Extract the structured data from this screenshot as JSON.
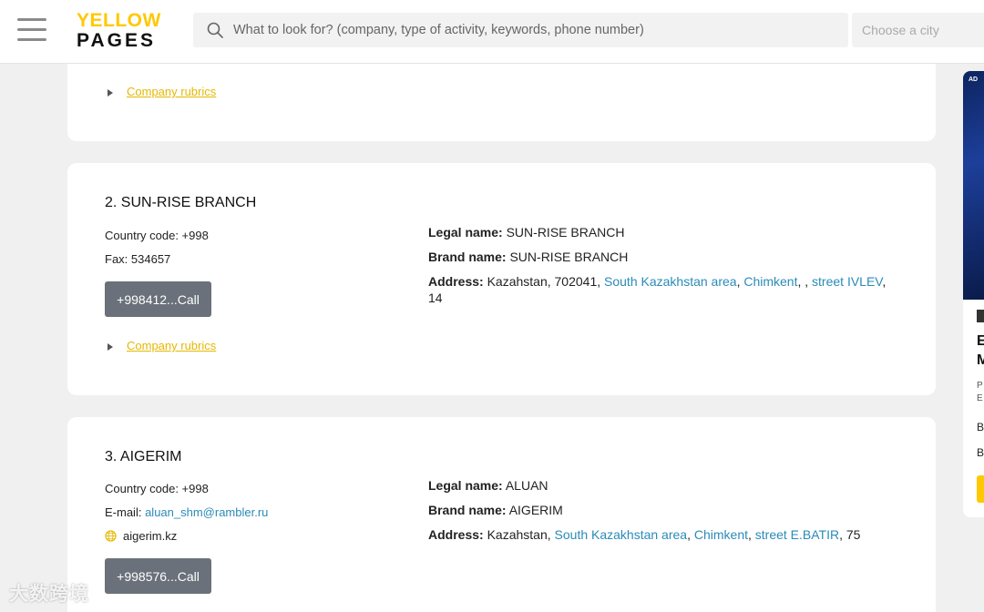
{
  "header": {
    "logo_top": "YELLOW",
    "logo_bottom": "PAGES",
    "search_placeholder": "What to look for? (company, type of activity, keywords, phone number)",
    "city_placeholder": "Choose a city"
  },
  "colors": {
    "accent": "#ffc800",
    "link": "#2a8bb8",
    "call_button": "#6b717a",
    "rubric_link": "#e6b800"
  },
  "card1": {
    "rubrics": "Company rubrics"
  },
  "card2": {
    "title": "2. SUN-RISE BRANCH",
    "country_code": "Country code: +998",
    "fax": "Fax: 534657",
    "call_label": "+998412...Call",
    "legal_label": "Legal name:",
    "legal_value": "SUN-RISE BRANCH",
    "brand_label": "Brand name:",
    "brand_value": "SUN-RISE BRANCH",
    "address_label": "Address:",
    "address_prefix": "Kazahstan, 702041,",
    "area": "South Kazakhstan area",
    "city": "Chimkent",
    "street": "street IVLEV",
    "number": "14",
    "rubrics": "Company rubrics"
  },
  "card3": {
    "title": "3. AIGERIM",
    "country_code": "Country code: +998",
    "email_label": "E-mail:",
    "email": "aluan_shm@rambler.ru",
    "website": "aigerim.kz",
    "call_label": "+998576...Call",
    "legal_label": "Legal name:",
    "legal_value": "ALUAN",
    "brand_label": "Brand name:",
    "brand_value": "AIGERIM",
    "address_label": "Address:",
    "address_prefix": "Kazahstan,",
    "area": "South Kazakhstan area",
    "city": "Chimkent",
    "street": "street E.BATIR",
    "number": "75"
  },
  "ad": {
    "badge": "AD",
    "line1": "E",
    "line2": "M",
    "small1": "P",
    "small2": "E",
    "item1": "B",
    "item2": "B"
  },
  "watermark": "大数跨境"
}
